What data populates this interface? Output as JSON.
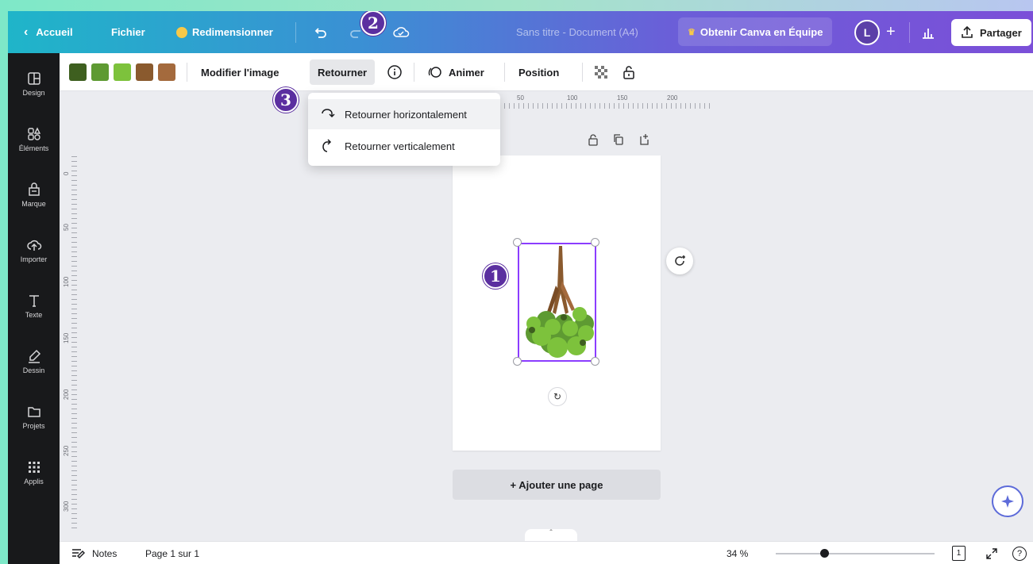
{
  "topbar": {
    "back_label": "Accueil",
    "file_label": "Fichier",
    "resize_label": "Redimensionner",
    "doc_title": "Sans titre - Document (A4)",
    "pro_label": "Obtenir Canva en Équipe",
    "avatar_initial": "L",
    "plus_label": "+",
    "share_label": "Partager"
  },
  "sidebar": {
    "items": [
      {
        "label": "Design"
      },
      {
        "label": "Éléments"
      },
      {
        "label": "Marque"
      },
      {
        "label": "Importer"
      },
      {
        "label": "Texte"
      },
      {
        "label": "Dessin"
      },
      {
        "label": "Projets"
      },
      {
        "label": "Applis"
      }
    ]
  },
  "toolbar": {
    "swatches": [
      "#3e5f1f",
      "#5e9a32",
      "#7dc23c",
      "#8a5a2e",
      "#a46a3d"
    ],
    "edit_image_label": "Modifier l'image",
    "flip_label": "Retourner",
    "animate_label": "Animer",
    "position_label": "Position"
  },
  "dropdown": {
    "flip_h_label": "Retourner horizontalement",
    "flip_v_label": "Retourner verticalement"
  },
  "ruler": {
    "top_ticks": [
      "50",
      "100",
      "150",
      "200"
    ],
    "left_ticks": [
      "0",
      "50",
      "100",
      "150",
      "200",
      "250",
      "300"
    ]
  },
  "canvas": {
    "add_page_label": "+ Ajouter une page"
  },
  "bottombar": {
    "notes_label": "Notes",
    "page_label": "Page 1 sur 1",
    "zoom_label": "34 %",
    "page_count": "1",
    "help_label": "?"
  },
  "badges": {
    "one": "1",
    "two": "2",
    "three": "3"
  }
}
